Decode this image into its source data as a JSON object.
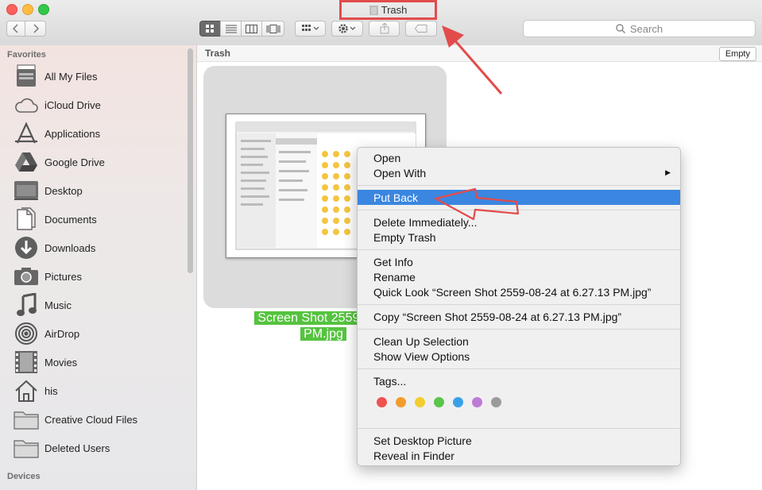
{
  "window": {
    "title": "Trash"
  },
  "search": {
    "placeholder": "Search"
  },
  "sidebar": {
    "favorites_heading": "Favorites",
    "devices_heading": "Devices",
    "items": [
      {
        "label": "All My Files"
      },
      {
        "label": "iCloud Drive"
      },
      {
        "label": "Applications"
      },
      {
        "label": "Google Drive"
      },
      {
        "label": "Desktop"
      },
      {
        "label": "Documents"
      },
      {
        "label": "Downloads"
      },
      {
        "label": "Pictures"
      },
      {
        "label": "Music"
      },
      {
        "label": "AirDrop"
      },
      {
        "label": "Movies"
      },
      {
        "label": "his"
      },
      {
        "label": "Creative Cloud Files"
      },
      {
        "label": "Deleted Users"
      }
    ]
  },
  "content": {
    "path_label": "Trash",
    "empty_button": "Empty",
    "file": {
      "name_line1": "Screen Shot 2559-08-2",
      "name_line2": "PM.jpg"
    }
  },
  "context_menu": {
    "open": "Open",
    "open_with": "Open With",
    "put_back": "Put Back",
    "delete_immediately": "Delete Immediately...",
    "empty_trash": "Empty Trash",
    "get_info": "Get Info",
    "rename": "Rename",
    "quick_look": "Quick Look “Screen Shot 2559-08-24 at 6.27.13 PM.jpg”",
    "copy": "Copy “Screen Shot 2559-08-24 at 6.27.13 PM.jpg”",
    "clean_up": "Clean Up Selection",
    "show_view_options": "Show View Options",
    "tags": "Tags...",
    "tag_colors": [
      "#f0524f",
      "#f39c2c",
      "#f2cd2f",
      "#5bc44a",
      "#3aa0e8",
      "#be7ad6",
      "#9b9b9b"
    ],
    "set_desktop_picture": "Set Desktop Picture",
    "reveal_in_finder": "Reveal in Finder"
  },
  "colors": {
    "highlight": "#3b86e0",
    "annotation_red": "#e34b4b",
    "selection_green": "#55c33f"
  }
}
